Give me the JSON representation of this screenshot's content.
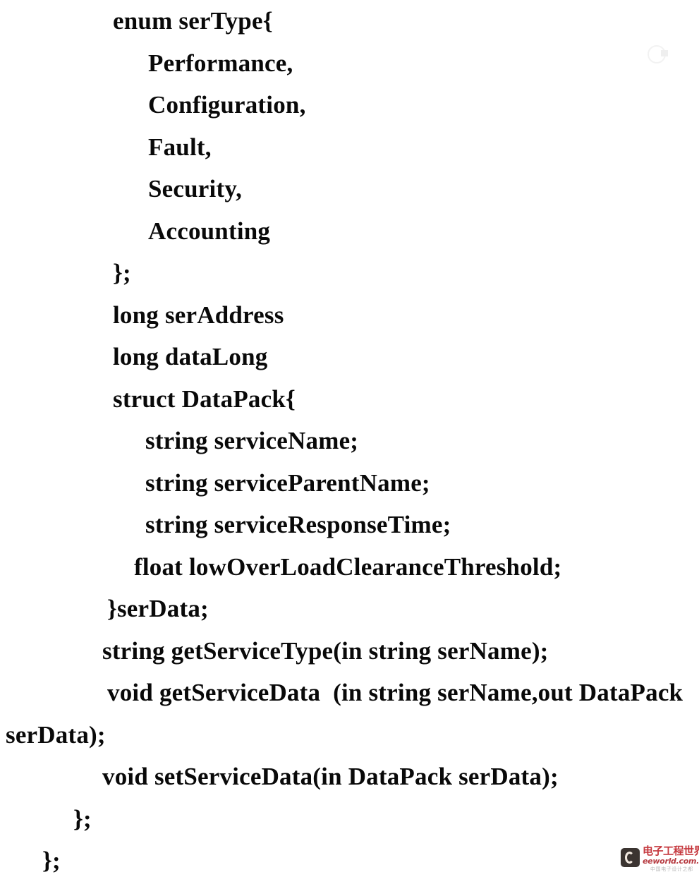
{
  "page": {
    "background_color": "#ffffff",
    "text_color": "#0a0a0a"
  },
  "code": {
    "language": "IDL",
    "lines": [
      {
        "indent": 5,
        "text": "enum serType{"
      },
      {
        "indent": 8,
        "text": "Performance,"
      },
      {
        "indent": 8,
        "text": "Configuration,"
      },
      {
        "indent": 8,
        "text": "Fault,"
      },
      {
        "indent": 8,
        "text": "Security,"
      },
      {
        "indent": 8,
        "text": "Accounting"
      },
      {
        "indent": 5,
        "text": "};"
      },
      {
        "indent": 5,
        "text": "long serAddress"
      },
      {
        "indent": 5,
        "text": "long dataLong"
      },
      {
        "indent": 5,
        "text": "struct DataPack{"
      },
      {
        "indent": 7,
        "text": "string serviceName;"
      },
      {
        "indent": 7,
        "text": "string serviceParentName;"
      },
      {
        "indent": 7,
        "text": "string serviceResponseTime;"
      },
      {
        "indent": 6,
        "text": "float lowOverLoadClearanceThreshold;"
      },
      {
        "indent": 4,
        "text": "}serData;"
      },
      {
        "indent": 3,
        "text": "string getServiceType(in string serName);"
      },
      {
        "indent": 4,
        "text": "void getServiceData  (in string serName,out DataPack"
      },
      {
        "indent": 0,
        "text": "serData);"
      },
      {
        "indent": 3,
        "text": "void setServiceData(in DataPack serData);"
      },
      {
        "indent": 2,
        "text": "};"
      },
      {
        "indent": 1,
        "text": "};"
      }
    ]
  },
  "watermarks": {
    "top_right": {
      "name": "faint-circle-mark",
      "visible": true
    },
    "bottom_right": {
      "brand_cn": "电子工程世界",
      "brand_en": "eeworld.com.cn",
      "tagline": "中国电子设计之都",
      "mark_letter": "C",
      "accent_color": "#c1272d",
      "mark_color": "#2b2320"
    }
  }
}
